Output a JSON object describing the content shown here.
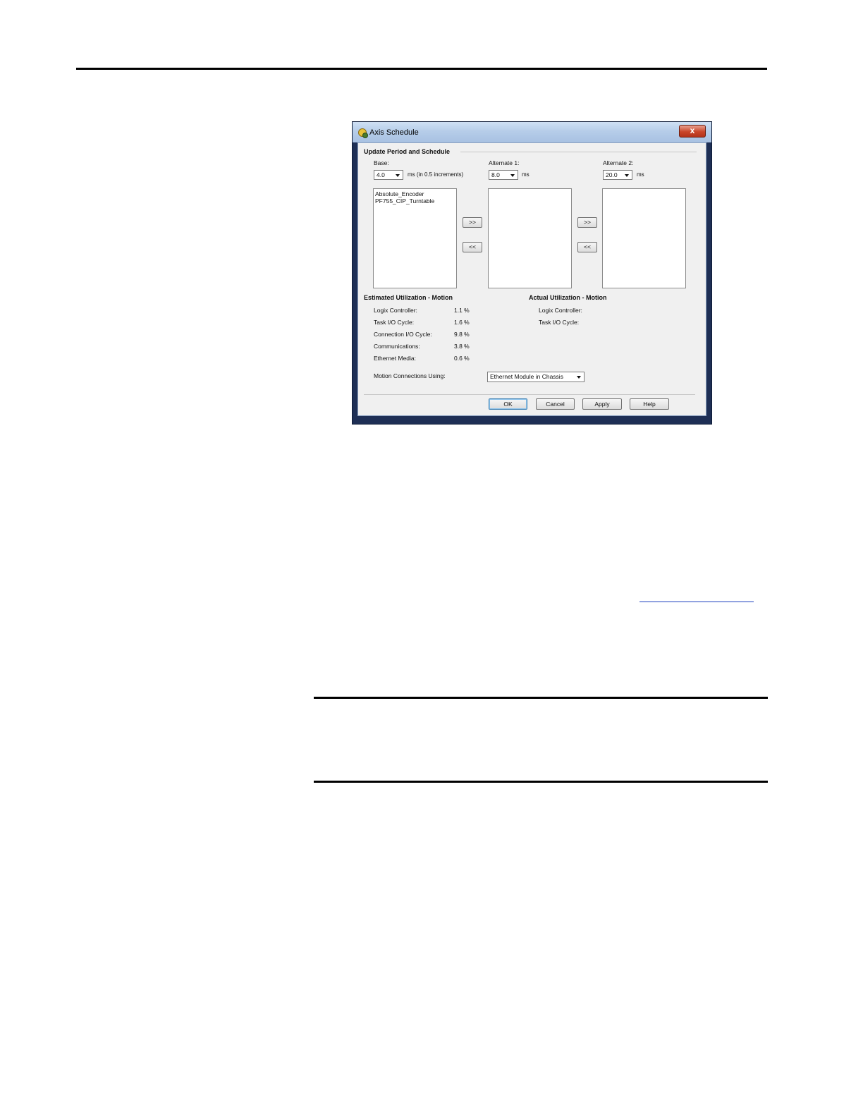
{
  "dialog": {
    "title": "Axis Schedule",
    "close_label": "x",
    "group_title": "Update Period and Schedule",
    "base": {
      "label": "Base:",
      "value": "4.0",
      "unit": "ms (in 0.5 increments)"
    },
    "alt1": {
      "label": "Alternate 1:",
      "value": "8.0",
      "unit": "ms"
    },
    "alt2": {
      "label": "Alternate 2:",
      "value": "20.0",
      "unit": "ms"
    },
    "base_list": [
      "Absolute_Encoder",
      "PF755_CIP_Turntable"
    ],
    "move_right": ">>",
    "move_left": "<<",
    "estimated": {
      "title": "Estimated Utilization - Motion",
      "rows": [
        {
          "label": "Logix Controller:",
          "value": "1.1 %"
        },
        {
          "label": "Task I/O Cycle:",
          "value": "1.6 %"
        },
        {
          "label": "Connection I/O Cycle:",
          "value": "9.8 %"
        },
        {
          "label": "Communications:",
          "value": "3.8 %"
        },
        {
          "label": "Ethernet Media:",
          "value": "0.6 %"
        }
      ]
    },
    "actual": {
      "title": "Actual Utilization - Motion",
      "rows": [
        {
          "label": "Logix Controller:"
        },
        {
          "label": "Task I/O Cycle:"
        }
      ]
    },
    "motion_connections": {
      "label": "Motion Connections Using:",
      "value": "Ethernet Module in Chassis"
    },
    "buttons": {
      "ok": "OK",
      "cancel": "Cancel",
      "apply": "Apply",
      "help": "Help"
    }
  }
}
